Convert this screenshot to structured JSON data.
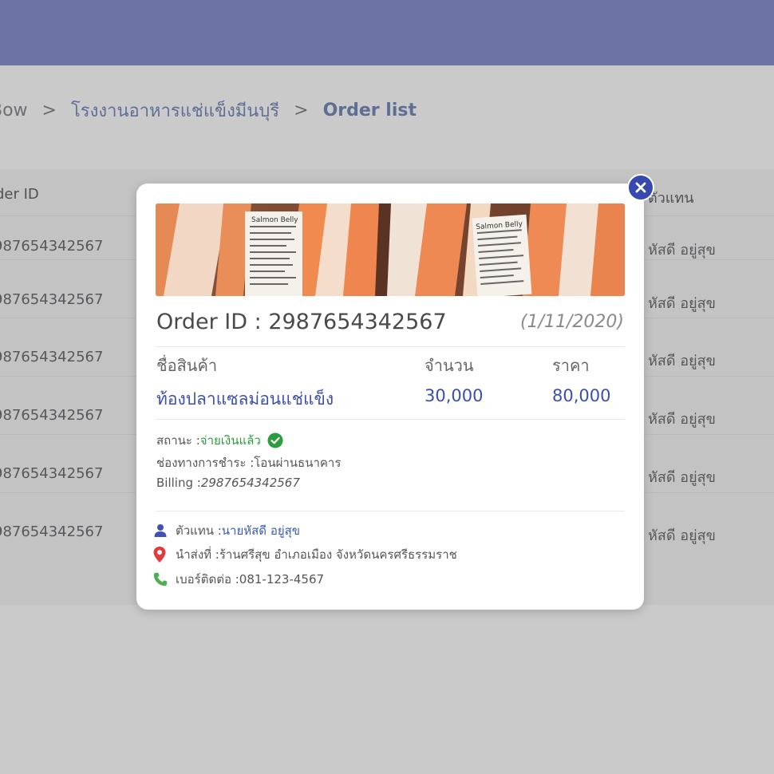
{
  "breadcrumb": {
    "items": [
      "Bow",
      "โรงงานอาหารแช่แข็งมีนบุรี",
      "Order list"
    ],
    "separator": ">"
  },
  "table": {
    "header_left": "der ID",
    "header_right": "ตัวแทน",
    "rows": [
      {
        "order_id": "987654342567",
        "agent": "หัสดี อยู่สุข"
      },
      {
        "order_id": "987654342567",
        "agent": "หัสดี อยู่สุข"
      },
      {
        "order_id": "987654342567",
        "agent": "หัสดี อยู่สุข"
      },
      {
        "order_id": "987654342567",
        "agent": "หัสดี อยู่สุข"
      },
      {
        "order_id": "987654342567",
        "agent": "หัสดี อยู่สุข"
      },
      {
        "order_id": "987654342567",
        "agent": "หัสดี อยู่สุข"
      }
    ]
  },
  "modal": {
    "photo_labels": [
      "Salmon Belly",
      "Salmon Belly"
    ],
    "order_title": "Order ID : 2987654342567",
    "order_date": "(1/11/2020)",
    "columns": {
      "product": "ชื่อสินค้า",
      "quantity": "จำนวน",
      "price": "ราคา"
    },
    "item": {
      "product": "ท้องปลาแซลม่อนแช่แข็ง",
      "quantity": "30,000",
      "price": "80,000"
    },
    "status_label": "สถานะ : ",
    "status_value": "จ่ายเงินแล้ว",
    "payment_label": "ช่องทางการชำระ : ",
    "payment_value": "โอนผ่านธนาคาร",
    "billing_label": "Billing : ",
    "billing_value": "2987654342567",
    "agent_label": "ตัวแทน : ",
    "agent_value": "นายหัสดี อยู่สุข",
    "delivery_label": "นำส่งที่ : ",
    "delivery_value": "ร้านศรีสุข อำเภอเมือง จังหวัดนครศรีธรรมราช",
    "phone_label": "เบอร์ติดต่อ : ",
    "phone_value": "081-123-4567"
  },
  "colors": {
    "header": "#6c74a6",
    "accent_blue": "#3c4fae",
    "status_green": "#2d9b3f",
    "close_button": "#3748b0",
    "location_red": "#e23b3b",
    "phone_green": "#4caf50"
  },
  "icons": [
    "close-icon",
    "chevron-right-icon",
    "check-circle-icon",
    "user-icon",
    "map-pin-icon",
    "phone-icon"
  ]
}
